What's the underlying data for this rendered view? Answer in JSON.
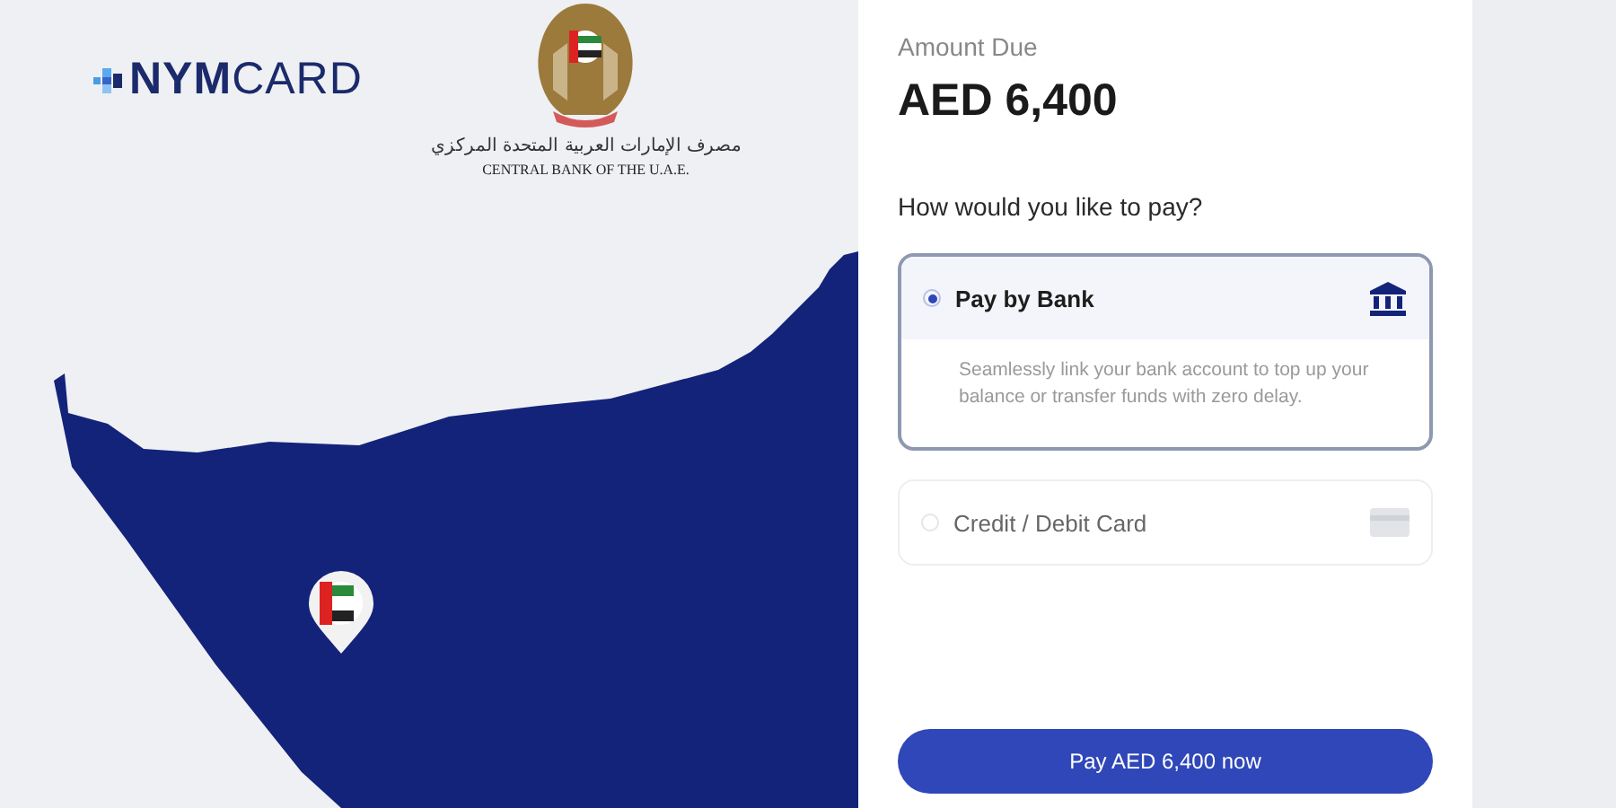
{
  "logo": {
    "text": "**NYM**CARD"
  },
  "emblem": {
    "arabic": "مصرف الإمارات العربية المتحدة المركزي",
    "english": "CENTRAL BANK OF THE U.A.E."
  },
  "payment": {
    "amount_label": "Amount Due",
    "amount": "AED 6,400",
    "question": "How would you like to pay?",
    "options": [
      {
        "kind": "bank",
        "label": "Pay by Bank",
        "selected": true,
        "description": "Seamlessly link your bank account to top up your balance or transfer funds with zero delay."
      },
      {
        "kind": "card",
        "label": "Credit / Debit Card",
        "selected": false
      }
    ],
    "button": "Pay AED 6,400 now"
  }
}
